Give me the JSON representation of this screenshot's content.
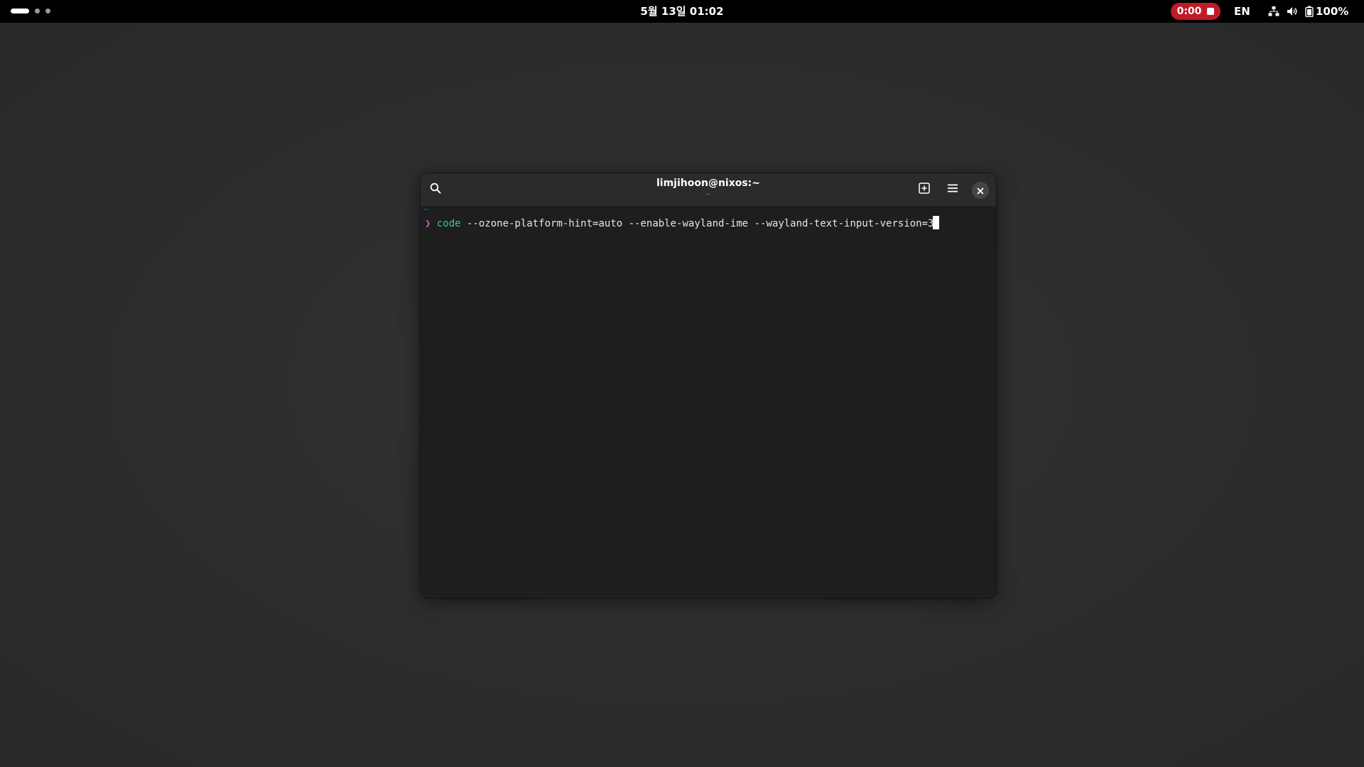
{
  "topbar": {
    "clock": "5월 13일 01:02",
    "recording_time": "0:00",
    "language": "EN",
    "battery": "100%",
    "icons": [
      "network-icon",
      "volume-icon",
      "battery-icon",
      "stop-icon"
    ]
  },
  "terminal": {
    "title": "limjihoon@nixos:~",
    "subtitle": "~",
    "cwd": "~",
    "prompt_symbol": "❯",
    "command": "code",
    "arguments": " --ozone-platform-hint=auto --enable-wayland-ime --wayland-text-input-version=3",
    "header_icons": [
      "search-icon",
      "new-tab-icon",
      "menu-icon",
      "close-icon"
    ]
  },
  "colors": {
    "recording_pill": "#c01c28",
    "prompt": "#c061cb",
    "command": "#33d17a",
    "cwd": "#3f76c9"
  }
}
